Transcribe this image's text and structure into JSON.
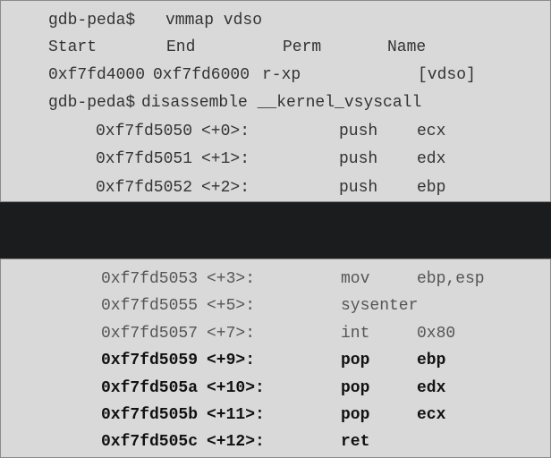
{
  "top": {
    "cmd1": {
      "prompt": "gdb-peda$",
      "command": "vmmap vdso"
    },
    "vmmap_header": {
      "start": "Start",
      "end": "End",
      "perm": "Perm",
      "name": "Name"
    },
    "vmmap_row": {
      "start": "0xf7fd4000",
      "end": "0xf7fd6000",
      "perm": "r-xp",
      "name": "[vdso]"
    },
    "cmd2": {
      "prompt": "gdb-peda$",
      "command": "disassemble __kernel_vsyscall"
    },
    "instructions": [
      {
        "addr": "0xf7fd5050",
        "offset": "<+0>:",
        "mnemonic": "push",
        "operand": "ecx"
      },
      {
        "addr": "0xf7fd5051",
        "offset": "<+1>:",
        "mnemonic": "push",
        "operand": "edx"
      },
      {
        "addr": "0xf7fd5052",
        "offset": "<+2>:",
        "mnemonic": "push",
        "operand": "ebp"
      }
    ]
  },
  "bottom": {
    "instructions": [
      {
        "addr": "0xf7fd5053",
        "offset": "<+3>:",
        "mnemonic": "mov",
        "operand": "ebp,esp"
      },
      {
        "addr": "0xf7fd5055",
        "offset": "<+5>:",
        "mnemonic": "sysenter",
        "operand": ""
      },
      {
        "addr": "0xf7fd5057",
        "offset": "<+7>:",
        "mnemonic": "int",
        "operand": "0x80"
      },
      {
        "addr": "0xf7fd5059",
        "offset": "<+9>:",
        "mnemonic": "pop",
        "operand": "ebp"
      },
      {
        "addr": "0xf7fd505a",
        "offset": "<+10>:",
        "mnemonic": "pop",
        "operand": "edx"
      },
      {
        "addr": "0xf7fd505b",
        "offset": "<+11>:",
        "mnemonic": "pop",
        "operand": "ecx"
      },
      {
        "addr": "0xf7fd505c",
        "offset": "<+12>:",
        "mnemonic": "ret",
        "operand": ""
      }
    ]
  }
}
